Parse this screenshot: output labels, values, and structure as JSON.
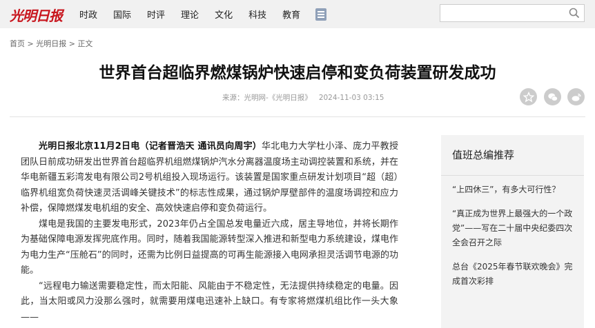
{
  "site": {
    "logo": "光明日报"
  },
  "nav": {
    "items": [
      "时政",
      "国际",
      "时评",
      "理论",
      "文化",
      "科技",
      "教育"
    ]
  },
  "search": {
    "placeholder": ""
  },
  "breadcrumb": {
    "home": "首页",
    "sep1": " > ",
    "section": "光明日报",
    "sep2": " > ",
    "current": "正文"
  },
  "article": {
    "title": "世界首台超临界燃煤锅炉快速启停和变负荷装置研发成功",
    "source": "来源：光明网-《光明日报》",
    "datetime": "2024-11-03 03:15",
    "lead": "光明日报北京11月2日电（记者晋浩天 通讯员向周宇）",
    "p1_rest": "华北电力大学杜小泽、庞力平教授团队日前成功研发出世界首台超临界机组燃煤锅炉汽水分离器温度场主动调控装置和系统，并在华电新疆五彩湾发电有限公司2号机组投入现场运行。该装置是国家重点研发计划项目“超（超）临界机组宽负荷快速灵活调峰关键技术”的标志性成果，通过锅炉厚壁部件的温度场调控和应力补偿，保障燃煤发电机组的安全、高效快速启停和变负荷运行。",
    "p2": "煤电是我国的主要发电形式，2023年仍占全国总发电量近六成，居主导地位，并将长期作为基础保障电源发挥兜底作用。同时，随着我国能源转型深入推进和新型电力系统建设，煤电作为电力生产“压舱石”的同时，还需为比例日益提高的可再生能源接入电网承担灵活调节电源的功能。",
    "p3": "“远程电力输送需要稳定性，而太阳能、风能由于不稳定性，无法提供持续稳定的电量。因此，当太阳或风力没那么强时，就需要用煤电迅速补上缺口。有专家将燃煤机组比作一头大象——"
  },
  "sidebar": {
    "title": "值班总编推荐",
    "items": [
      "“上四休三”，有多大可行性？",
      "“真正成为世界上最强大的一个政党”——写在二十届中央纪委四次全会召开之际",
      "总台《2025年春节联欢晚会》完成首次彩排"
    ]
  },
  "colors": {
    "brand_red": "#c8151d",
    "topbar_bg": "#f1f1f1",
    "sidebar_bg": "#f3f3f3",
    "share_icon_bg": "#cccccc"
  },
  "icons": {
    "menu": "menu-icon",
    "search": "search-icon",
    "share": [
      "star-icon",
      "wechat-icon",
      "weibo-icon"
    ]
  }
}
